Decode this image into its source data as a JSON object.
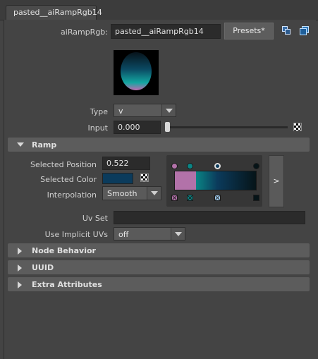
{
  "tab": {
    "label": "pasted__aiRampRgb14"
  },
  "header": {
    "node_label": "aiRampRgb:",
    "node_name": "pasted__aiRampRgb14",
    "presets_label": "Presets*"
  },
  "type_field": {
    "label": "Type",
    "value": "v"
  },
  "input_field": {
    "label": "Input",
    "value": "0.000",
    "slider_fraction": 0.0
  },
  "ramp": {
    "section_label": "Ramp",
    "selected_position_label": "Selected Position",
    "selected_position_value": "0.522",
    "selected_color_label": "Selected Color",
    "selected_color": "#0b3b5c",
    "interpolation_label": "Interpolation",
    "interpolation_value": "Smooth",
    "expand_label": ">",
    "stops": [
      {
        "position": 0.0,
        "color": "#b272a9"
      },
      {
        "position": 0.19,
        "color": "#0a8585"
      },
      {
        "position": 0.522,
        "color": "#0b3b5c",
        "selected": true
      },
      {
        "position": 1.0,
        "color": "#061418"
      }
    ]
  },
  "uv_set": {
    "label": "Uv Set",
    "value": ""
  },
  "implicit_uvs": {
    "label": "Use Implicit UVs",
    "value": "off"
  },
  "sections": {
    "node_behavior": "Node Behavior",
    "uuid": "UUID",
    "extra_attributes": "Extra Attributes"
  }
}
